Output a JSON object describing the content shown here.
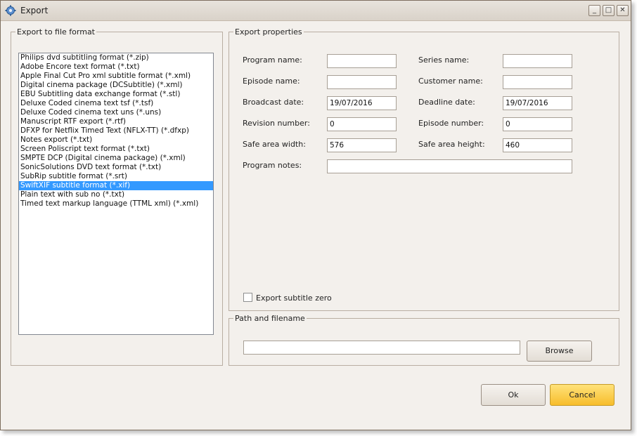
{
  "window": {
    "title": "Export",
    "controls": {
      "minimize": "_",
      "maximize": "□",
      "close": "✕"
    }
  },
  "format_group": {
    "legend": "Export to file format",
    "items": [
      "Philips dvd subtitling format (*.zip)",
      "Adobe Encore text format (*.txt)",
      "Apple Final Cut Pro xml subtitle format (*.xml)",
      "Digital cinema package (DCSubtitle) (*.xml)",
      "EBU Subtitling data exchange format (*.stl)",
      "Deluxe Coded cinema text tsf (*.tsf)",
      "Deluxe Coded cinema text uns (*.uns)",
      "Manuscript RTF export (*.rtf)",
      "DFXP for Netflix Timed Text (NFLX-TT) (*.dfxp)",
      "Notes export (*.txt)",
      "Screen Poliscript text format (*.txt)",
      "SMPTE DCP (Digital cinema package) (*.xml)",
      "SonicSolutions DVD text format (*.txt)",
      "SubRip subtitle format (*.srt)",
      "SwiftXIF subtitle format (*.xif)",
      "Plain text with sub no (*.txt)",
      "Timed text markup language (TTML xml) (*.xml)"
    ],
    "selected_item": "SwiftXIF subtitle format (*.xif)"
  },
  "properties_group": {
    "legend": "Export properties",
    "program_name": {
      "label": "Program name:",
      "value": ""
    },
    "series_name": {
      "label": "Series name:",
      "value": ""
    },
    "episode_name": {
      "label": "Episode name:",
      "value": ""
    },
    "customer_name": {
      "label": "Customer name:",
      "value": ""
    },
    "broadcast_date": {
      "label": "Broadcast date:",
      "value": "19/07/2016"
    },
    "deadline_date": {
      "label": "Deadline date:",
      "value": "19/07/2016"
    },
    "revision_number": {
      "label": "Revision number:",
      "value": "0"
    },
    "episode_number": {
      "label": "Episode number:",
      "value": "0"
    },
    "safe_area_width": {
      "label": "Safe area width:",
      "value": "576"
    },
    "safe_area_height": {
      "label": "Safe area height:",
      "value": "460"
    },
    "program_notes": {
      "label": "Program notes:",
      "value": ""
    },
    "export_subtitle_zero": {
      "label": "Export subtitle zero",
      "checked": false
    }
  },
  "path_group": {
    "legend": "Path and filename",
    "path_value": "",
    "browse_label": "Browse"
  },
  "buttons": {
    "ok": "Ok",
    "cancel": "Cancel"
  },
  "colors": {
    "selection": "#3399ff",
    "window_bg": "#f3f0ec",
    "primary_button": "#f7bd2b"
  }
}
